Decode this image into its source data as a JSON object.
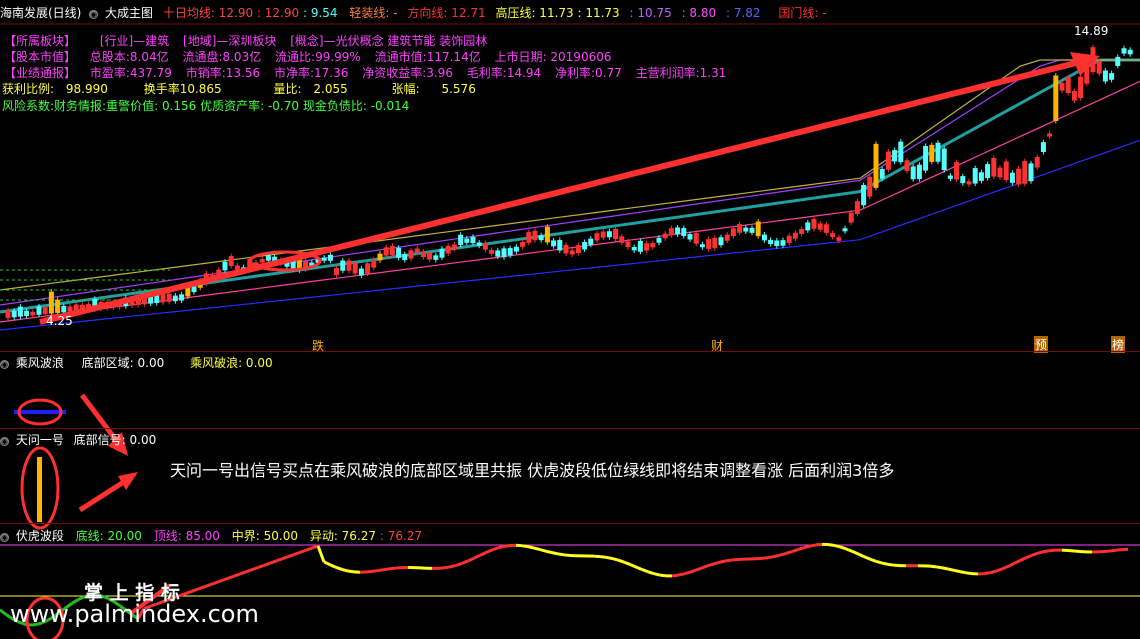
{
  "header": {
    "title": "海南发展(日线)",
    "main_indicator": "大成主图",
    "ma_label": "十日均线:",
    "ma_values": "12.90 : 12.90",
    "ma_extra": ": 9.54",
    "light_label": "轻装线: -",
    "dir_label": "方向线: 12.71",
    "pressure_label": "高压线: 11.73 : 11.73",
    "v1": ": 10.75",
    "v2": ": 8.80",
    "v3": ": 7.82",
    "gate_label": "国门线: -"
  },
  "info": {
    "row1": [
      "【所属板块】",
      "[行业]—建筑",
      "[地域]—深圳板块",
      "[概念]—光伏概念 建筑节能 装饰园林"
    ],
    "row2": [
      "【股本市值】",
      "总股本:8.04亿",
      "流通盘:8.03亿",
      "流通比:99.99%",
      "流通市值:117.14亿",
      "上市日期: 20190606"
    ],
    "row3": [
      "【业绩通报】",
      "市盈率:437.79",
      "市销率:13.56",
      "市净率:17.36",
      "净资收益率:3.96",
      "毛利率:14.94",
      "净利率:0.77",
      "主营利润率:1.31"
    ],
    "row4": [
      "获利比例:",
      "98.990",
      "换手率10.865",
      "量比:",
      "2.055",
      "张幅:",
      "5.576"
    ],
    "row5": "风险系数:财务情报:重警价值: 0.156 优质资产率: -0.70 现金负债比: -0.014"
  },
  "price_labels": {
    "high": "14.89",
    "low": "4.25"
  },
  "markers": {
    "m1": "跌",
    "m2": "财",
    "m3": "预",
    "m4": "榜"
  },
  "panel2": {
    "name": "乘风波浪",
    "bottom_label": "底部区域: 0.00",
    "break_label": "乘风破浪: 0.00"
  },
  "panel3": {
    "name": "天问一号",
    "signal_label": "底部信号: 0.00"
  },
  "annotation": "天问一号出信号买点在乘风破浪的底部区域里共振 伏虎波段低位绿线即将结束调整看涨 后面利润3倍多",
  "panel4": {
    "name": "伏虎波段",
    "base": "底线: 20.00",
    "top": "顶线: 85.00",
    "mid": "中界: 50.00",
    "move": "异动: 76.27",
    "move2": ": 76.27"
  },
  "watermark": {
    "chars": "掌 上 指 标",
    "url": "www.palmindex.com"
  },
  "colors": {
    "up": "#ff3232",
    "down": "#54ffff",
    "gold": "#ffb400",
    "magenta": "#ff00ff",
    "yellow": "#ffff00"
  }
}
